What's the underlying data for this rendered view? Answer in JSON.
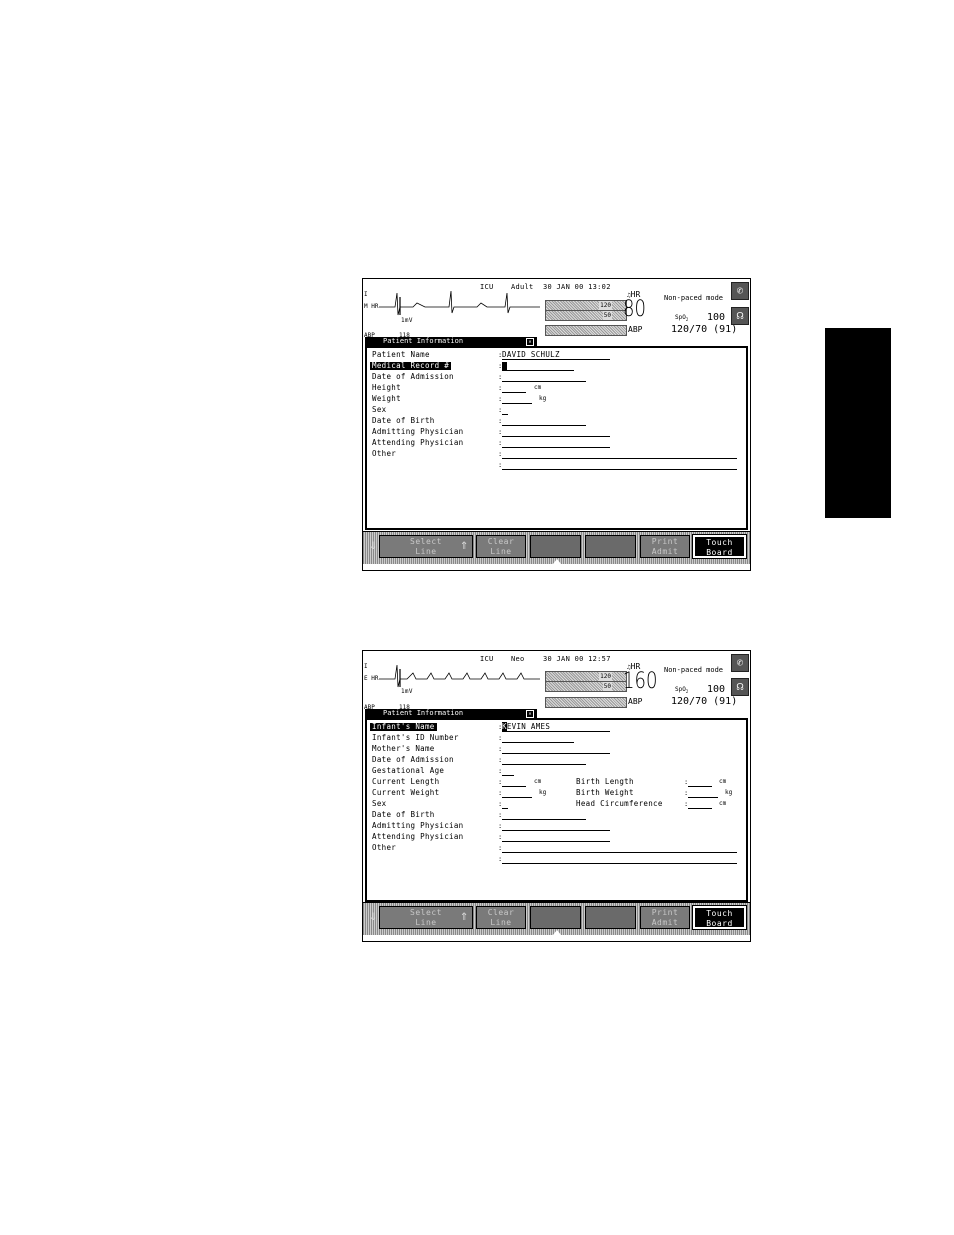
{
  "screens": [
    {
      "header": {
        "unit": "ICU",
        "patient_type": "Adult",
        "datetime": "30 JAN 00 13:02",
        "lead_top": "I",
        "lead_label": "M HR",
        "scale": "1mV",
        "abp_trace_label": "ABP",
        "abp_trace_scale": "118"
      },
      "vitals": {
        "hr_label": "HR",
        "hr_alarm_high": "120",
        "hr_alarm_low": "50",
        "hr_value": "80",
        "abp_label": "ABP",
        "pace_mode": "Non-paced mode",
        "spo2_label": "SpO",
        "spo2_sub": "2",
        "spo2_value": "100",
        "abp_value": "120/70 (91)"
      },
      "window": {
        "title": "Patient Information",
        "fields": [
          {
            "label": "Patient Name",
            "value": "DAVID SCHULZ",
            "selected": false
          },
          {
            "label": "Medical Record #",
            "value": "",
            "selected": true
          },
          {
            "label": "Date of Admission",
            "value": "",
            "selected": false
          },
          {
            "label": "Height",
            "value": "",
            "unit": "cm",
            "selected": false
          },
          {
            "label": "Weight",
            "value": "",
            "unit": "kg",
            "selected": false
          },
          {
            "label": "Sex",
            "value": "",
            "selected": false
          },
          {
            "label": "Date of Birth",
            "value": "",
            "selected": false
          },
          {
            "label": "Admitting Physician",
            "value": "",
            "selected": false
          },
          {
            "label": "Attending Physician",
            "value": "",
            "selected": false
          },
          {
            "label": "Other",
            "value": "",
            "selected": false
          }
        ]
      },
      "softkeys": {
        "select_line": "Select\nLine",
        "clear_line": "Clear\nLine",
        "print_admit": "Print\nAdmit",
        "touch_board": "Touch\nBoard"
      }
    },
    {
      "header": {
        "unit": "ICU",
        "patient_type": "Neo",
        "datetime": "30 JAN 00 12:57",
        "lead_top": "I",
        "lead_label": "E HR",
        "scale": "1mV",
        "abp_trace_label": "ABP",
        "abp_trace_scale": "118"
      },
      "vitals": {
        "hr_label": "HR",
        "hr_alarm_high": "120",
        "hr_alarm_low": "50",
        "hr_value": "160",
        "abp_label": "ABP",
        "pace_mode": "Non-paced mode",
        "spo2_label": "SpO",
        "spo2_sub": "2",
        "spo2_value": "100",
        "abp_value": "120/70 (91)"
      },
      "window": {
        "title": "Patient Information",
        "fields": [
          {
            "label": "Infant's Name",
            "value": "KEVIN AMES",
            "selected": true
          },
          {
            "label": "Infant's ID Number",
            "value": "",
            "selected": false
          },
          {
            "label": "Mother's Name",
            "value": "",
            "selected": false
          },
          {
            "label": "Date of Admission",
            "value": "",
            "selected": false
          },
          {
            "label": "Gestational Age",
            "value": "",
            "selected": false
          },
          {
            "label": "Current Length",
            "value": "",
            "unit": "cm",
            "selected": false
          },
          {
            "label": "Current Weight",
            "value": "",
            "unit": "kg",
            "selected": false
          },
          {
            "label": "Sex",
            "value": "",
            "selected": false
          },
          {
            "label": "Date of Birth",
            "value": "",
            "selected": false
          },
          {
            "label": "Admitting Physician",
            "value": "",
            "selected": false
          },
          {
            "label": "Attending Physician",
            "value": "",
            "selected": false
          },
          {
            "label": "Other",
            "value": "",
            "selected": false
          }
        ],
        "extra_fields": [
          {
            "label": "Birth Length",
            "unit": "cm"
          },
          {
            "label": "Birth Weight",
            "unit": "kg"
          },
          {
            "label": "Head Circumference",
            "unit": "cm"
          }
        ]
      },
      "softkeys": {
        "select_line": "Select\nLine",
        "clear_line": "Clear\nLine",
        "print_admit": "Print\nAdmit",
        "touch_board": "Touch\nBoard"
      }
    }
  ]
}
